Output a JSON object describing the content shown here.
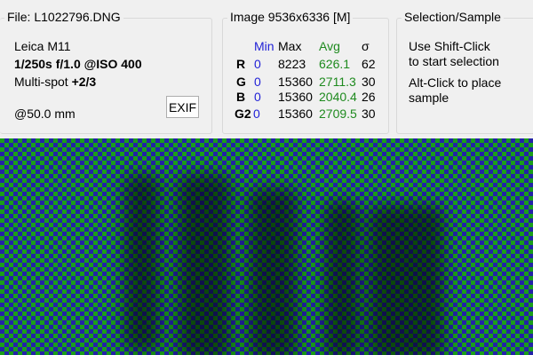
{
  "file_panel": {
    "title": "File: L1022796.DNG",
    "camera": "Leica M11",
    "exposure": "1/250s f/1.0 @ISO 400",
    "metering_label": "Multi-spot",
    "metering_value": "+2/3",
    "focal_length": "@50.0 mm",
    "exif_button": "EXIF"
  },
  "image_panel": {
    "title": "Image 9536x6336 [M]",
    "headers": {
      "min": "Min",
      "max": "Max",
      "avg": "Avg",
      "sigma": "σ"
    },
    "rows": [
      {
        "channel": "R",
        "min": "0",
        "max": "8223",
        "avg": "626.1",
        "sigma": "62"
      },
      {
        "channel": "G",
        "min": "0",
        "max": "15360",
        "avg": "2711.3",
        "sigma": "30"
      },
      {
        "channel": "B",
        "min": "0",
        "max": "15360",
        "avg": "2040.4",
        "sigma": "26"
      },
      {
        "channel": "G2",
        "min": "0",
        "max": "15360",
        "avg": "2709.5",
        "sigma": "30"
      }
    ]
  },
  "selection_panel": {
    "title": "Selection/Sample",
    "hint_line1": "Use Shift-Click",
    "hint_line2": "to start selection",
    "hint_line3": "Alt-Click to place",
    "hint_line4": "sample"
  },
  "colors": {
    "min_header": "#1f1fd6",
    "avg_header": "#1e8a1e",
    "preview_green": "#1a9e1a",
    "preview_blue": "#2323a8"
  }
}
